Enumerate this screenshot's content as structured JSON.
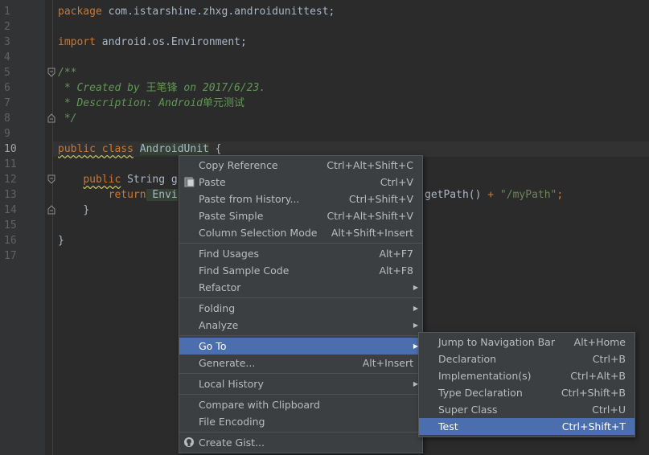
{
  "gutter": {
    "line_numbers": [
      "1",
      "2",
      "3",
      "4",
      "5",
      "6",
      "7",
      "8",
      "9",
      "10",
      "11",
      "12",
      "13",
      "14",
      "15",
      "16",
      "17"
    ]
  },
  "code": {
    "l1_kw": "package",
    "l1_rest": " com.istarshine.zhxg.androidunittest;",
    "l3_kw": "import",
    "l3_rest": " android.os.Environment;",
    "l5": "/**",
    "l6_a": " * Created by ",
    "l6_b": "王笔锋",
    "l6_c": " on 2017/6/23.",
    "l7_a": " * Description: Android",
    "l7_b": "单元测试",
    "l8": " */",
    "l10_kw": "public class",
    "l10_name": "AndroidUnit",
    "l10_rest": " {",
    "l12_kw": "public",
    "l12_type": " String g",
    "l13_kw": "return",
    "l13_name": " Envi",
    "l13_tail": "getPath() ",
    "l13_plus": "+",
    "l13_str": " \"/myPath\"",
    "l13_end": ";",
    "l14": "}",
    "l16": "}"
  },
  "menu": {
    "items": [
      {
        "label": "Copy Reference",
        "shortcut": "Ctrl+Alt+Shift+C"
      },
      {
        "label": "Paste",
        "shortcut": "Ctrl+V",
        "icon": "clipboard-icon"
      },
      {
        "label": "Paste from History...",
        "shortcut": "Ctrl+Shift+V"
      },
      {
        "label": "Paste Simple",
        "shortcut": "Ctrl+Alt+Shift+V"
      },
      {
        "label": "Column Selection Mode",
        "shortcut": "Alt+Shift+Insert"
      },
      {
        "label": "Find Usages",
        "shortcut": "Alt+F7"
      },
      {
        "label": "Find Sample Code",
        "shortcut": "Alt+F8"
      },
      {
        "label": "Refactor",
        "submenu": true
      },
      {
        "label": "Folding",
        "submenu": true
      },
      {
        "label": "Analyze",
        "submenu": true
      },
      {
        "label": "Go To",
        "submenu": true,
        "selected": true
      },
      {
        "label": "Generate...",
        "shortcut": "Alt+Insert"
      },
      {
        "label": "Local History",
        "submenu": true
      },
      {
        "label": "Compare with Clipboard"
      },
      {
        "label": "File Encoding"
      },
      {
        "label": "Create Gist...",
        "icon": "github-icon"
      }
    ]
  },
  "submenu": {
    "items": [
      {
        "label": "Jump to Navigation Bar",
        "shortcut": "Alt+Home"
      },
      {
        "label": "Declaration",
        "shortcut": "Ctrl+B"
      },
      {
        "label": "Implementation(s)",
        "shortcut": "Ctrl+Alt+B"
      },
      {
        "label": "Type Declaration",
        "shortcut": "Ctrl+Shift+B"
      },
      {
        "label": "Super Class",
        "shortcut": "Ctrl+U"
      },
      {
        "label": "Test",
        "shortcut": "Ctrl+Shift+T",
        "selected": true
      }
    ]
  },
  "colors": {
    "editor_bg": "#2b2b2b",
    "keyword": "#cc7832",
    "comment": "#629755",
    "string": "#6a8759",
    "menu_bg": "#3c3f41",
    "menu_selected": "#4b6eaf"
  }
}
